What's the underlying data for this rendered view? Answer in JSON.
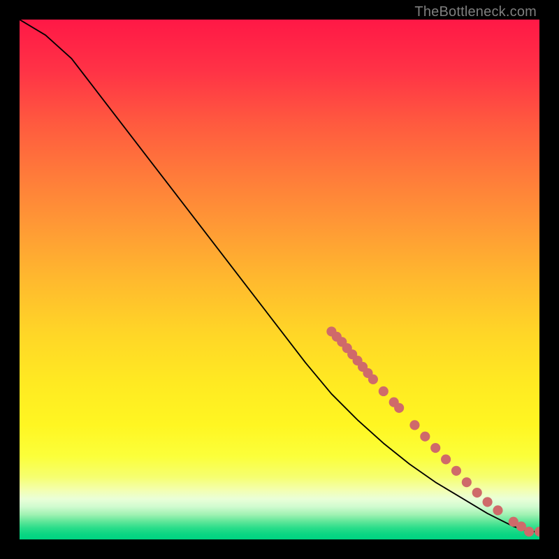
{
  "watermark": {
    "text": "TheBottleneck.com"
  },
  "chart_data": {
    "type": "line",
    "xlabel": "",
    "ylabel": "",
    "xlim": [
      0,
      100
    ],
    "ylim": [
      0,
      100
    ],
    "grid": false,
    "legend": false,
    "series": [
      {
        "name": "curve",
        "x": [
          0,
          5,
          10,
          15,
          20,
          25,
          30,
          35,
          40,
          45,
          50,
          55,
          60,
          65,
          70,
          75,
          80,
          85,
          90,
          95,
          98,
          100
        ],
        "y": [
          100,
          97,
          92.5,
          86,
          79.5,
          73,
          66.5,
          60,
          53.5,
          47,
          40.5,
          34,
          28,
          23,
          18.5,
          14.5,
          11,
          8,
          5,
          2.5,
          1.5,
          1.5
        ],
        "color": "#000000"
      }
    ],
    "marker_points": {
      "name": "highlighted-segment",
      "color": "#cf6a6a",
      "x": [
        60,
        61,
        62,
        63,
        64,
        65,
        66,
        67,
        68,
        70,
        72,
        73,
        76,
        78,
        80,
        82,
        84,
        86,
        88,
        90,
        92,
        95,
        96.5,
        98,
        100
      ],
      "y": [
        40,
        39,
        38,
        36.8,
        35.6,
        34.4,
        33.2,
        32,
        30.8,
        28.5,
        26.4,
        25.3,
        22,
        19.8,
        17.6,
        15.4,
        13.2,
        11,
        9,
        7.2,
        5.6,
        3.4,
        2.5,
        1.5,
        1.5
      ]
    },
    "gradient_stops": [
      {
        "offset": 0.0,
        "color": "#ff1846"
      },
      {
        "offset": 0.1,
        "color": "#ff3346"
      },
      {
        "offset": 0.2,
        "color": "#ff5a3f"
      },
      {
        "offset": 0.3,
        "color": "#ff7b3a"
      },
      {
        "offset": 0.4,
        "color": "#ff9a35"
      },
      {
        "offset": 0.5,
        "color": "#ffb92e"
      },
      {
        "offset": 0.6,
        "color": "#ffd527"
      },
      {
        "offset": 0.7,
        "color": "#ffea22"
      },
      {
        "offset": 0.78,
        "color": "#fff622"
      },
      {
        "offset": 0.84,
        "color": "#fbff3a"
      },
      {
        "offset": 0.88,
        "color": "#f6ff70"
      },
      {
        "offset": 0.905,
        "color": "#f3ffb0"
      },
      {
        "offset": 0.922,
        "color": "#eaffd8"
      },
      {
        "offset": 0.937,
        "color": "#d0fbcf"
      },
      {
        "offset": 0.952,
        "color": "#a1f2b3"
      },
      {
        "offset": 0.965,
        "color": "#62e79a"
      },
      {
        "offset": 0.978,
        "color": "#29dd8a"
      },
      {
        "offset": 0.99,
        "color": "#0ad683"
      },
      {
        "offset": 1.0,
        "color": "#00d482"
      }
    ]
  }
}
